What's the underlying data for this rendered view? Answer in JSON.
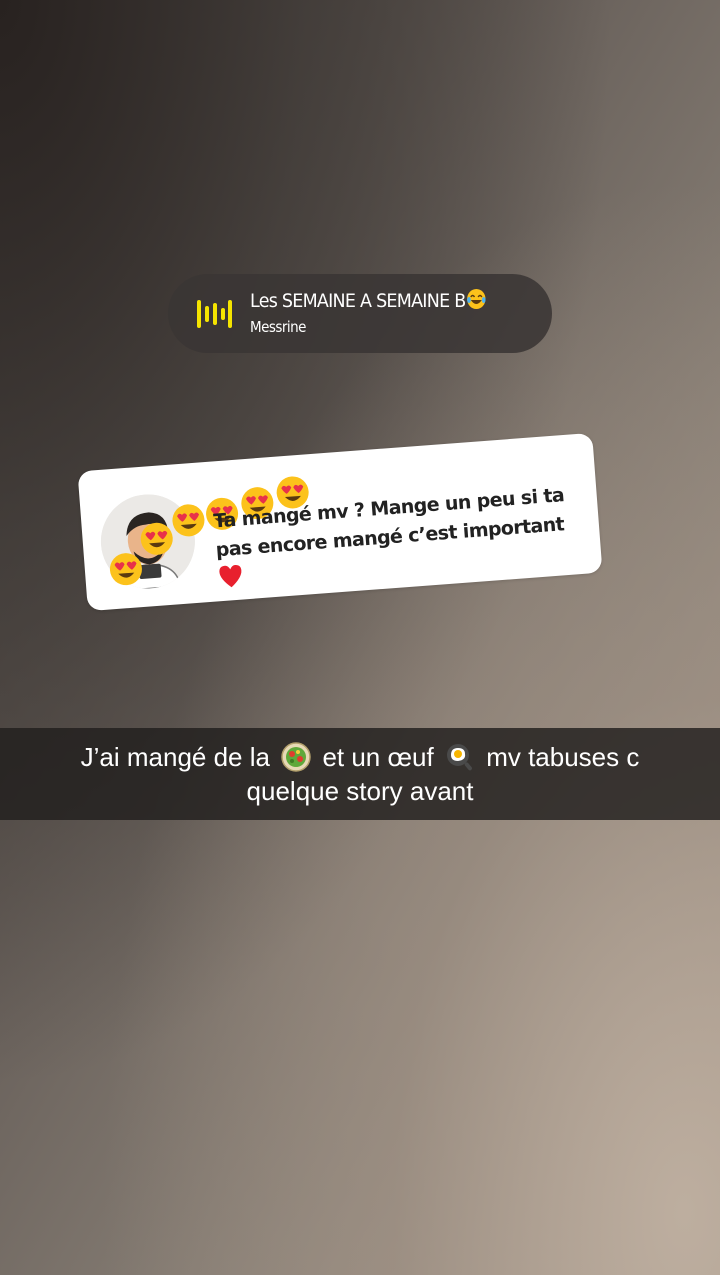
{
  "music_sticker": {
    "title": "Les SEMAINE A SEMAINE B",
    "title_emoji": "face-with-tears-of-joy-emoji",
    "artist": "Messrine",
    "icon": "soundwave-icon",
    "accent_color": "#f5e400"
  },
  "reply_card": {
    "text": "Ta mangé mv ? Mange un peu si ta pas encore mangé c’est important",
    "emojis": [
      "heart-eyes-emoji",
      "heart-eyes-emoji",
      "heart-eyes-emoji",
      "heart-eyes-emoji",
      "heart-eyes-emoji",
      "heart-eyes-emoji"
    ],
    "end_emoji": "red-heart-emoji"
  },
  "caption": {
    "line1_a": "J’ai mangé de la",
    "line1_b": "et un œuf",
    "line1_c": "mv tabuses c",
    "line2": "quelque story avant",
    "emoji_1": "salad-emoji",
    "emoji_2": "fried-egg-emoji"
  }
}
